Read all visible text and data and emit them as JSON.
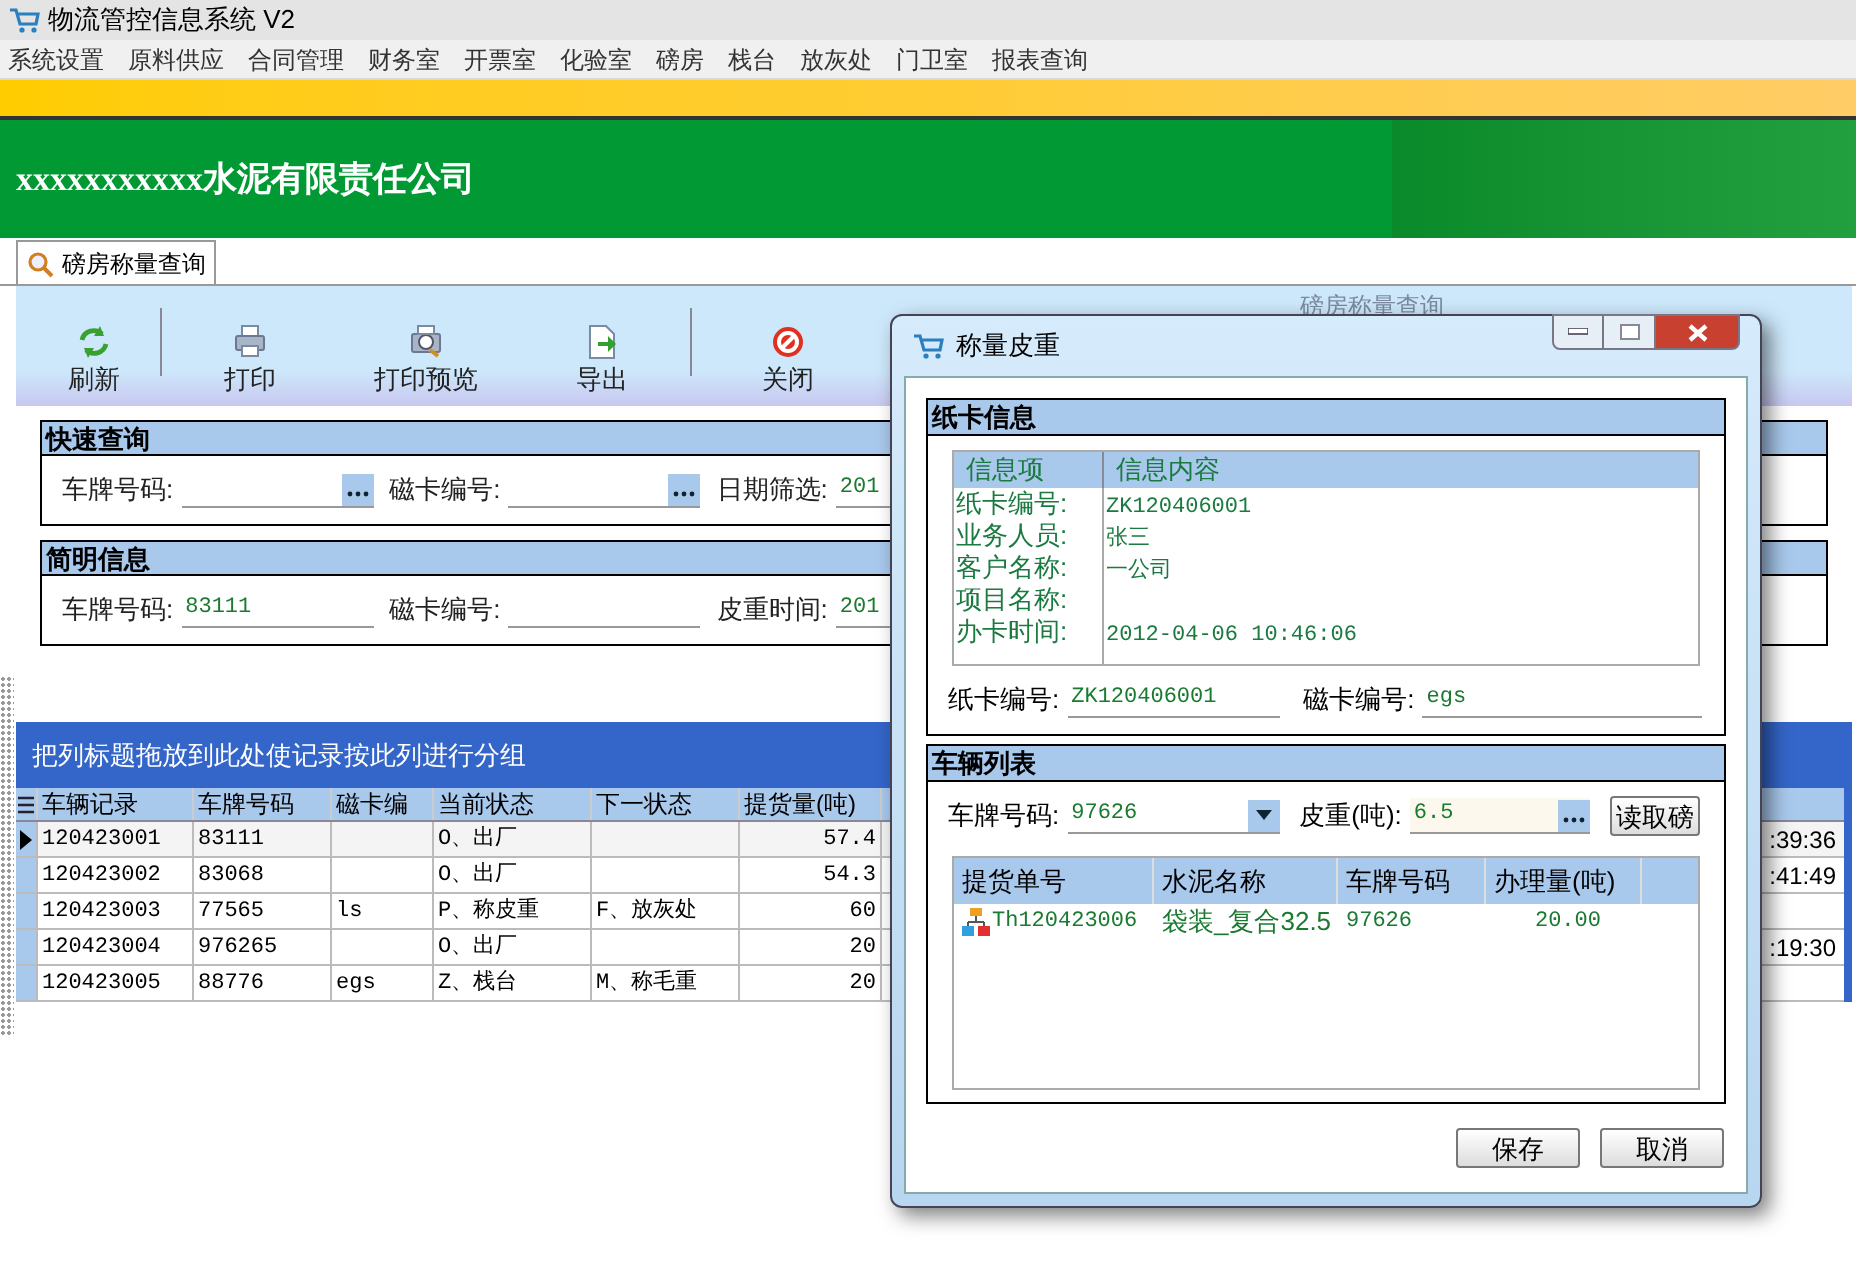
{
  "window": {
    "title": "物流管控信息系统 V2"
  },
  "menu": [
    "系统设置",
    "原料供应",
    "合同管理",
    "财务室",
    "开票室",
    "化验室",
    "磅房",
    "栈台",
    "放灰处",
    "门卫室",
    "报表查询"
  ],
  "banner": {
    "company": "xxxxxxxxxxx水泥有限责任公司"
  },
  "tabs": [
    {
      "label": "磅房称量查询",
      "selected": true
    }
  ],
  "toolbar": {
    "caption": "磅房称量查询",
    "buttons": [
      {
        "label": "刷新"
      },
      {
        "label": "打印"
      },
      {
        "label": "打印预览"
      },
      {
        "label": "导出"
      },
      {
        "label": "关闭"
      }
    ]
  },
  "quick_query": {
    "title": "快速查询",
    "fields": [
      {
        "label": "车牌号码:",
        "kind": "lookup"
      },
      {
        "label": "磁卡编号:",
        "kind": "lookup"
      },
      {
        "label": "日期筛选:",
        "value": "201",
        "kind": "text"
      }
    ]
  },
  "summary": {
    "title": "简明信息",
    "fields": [
      {
        "label": "车牌号码:",
        "value": "83111"
      },
      {
        "label": "磁卡编号:"
      },
      {
        "label": "皮重时间:",
        "value": "201"
      }
    ]
  },
  "grid": {
    "group_hint": "把列标题拖放到此处使记录按此列进行分组",
    "columns": [
      "车辆记录",
      "车牌号码",
      "磁卡编",
      "当前状态",
      "下一状态",
      "提货量(吨)"
    ],
    "rows": [
      {
        "selected": true,
        "cells": [
          "120423001",
          "83111",
          null,
          "O、出厂",
          null,
          "57.4"
        ],
        "column_7": ":39:36"
      },
      {
        "selected": false,
        "cells": [
          "120423002",
          "83068",
          null,
          "O、出厂",
          null,
          "54.3"
        ],
        "column_7": ":41:49"
      },
      {
        "selected": false,
        "cells": [
          "120423003",
          "77565",
          "ls",
          "P、称皮重",
          "F、放灰处",
          "60"
        ]
      },
      {
        "selected": false,
        "cells": [
          "120423004",
          "976265",
          null,
          "O、出厂",
          null,
          "20"
        ],
        "column_7": ":19:30"
      },
      {
        "selected": false,
        "cells": [
          "120423005",
          "88776",
          "egs",
          "Z、栈台",
          "M、称毛重",
          "20"
        ]
      }
    ]
  },
  "dialog": {
    "title": "称量皮重",
    "card_info": {
      "title": "纸卡信息",
      "columns": [
        "信息项",
        "信息内容"
      ],
      "rows": [
        {
          "item": "纸卡编号:",
          "content": "ZK120406001"
        },
        {
          "item": "业务人员:",
          "content": "张三"
        },
        {
          "item": "客户名称:",
          "content": "一公司"
        },
        {
          "item": "项目名称:"
        },
        {
          "item": "办卡时间:",
          "content": "2012-04-06 10:46:06"
        }
      ],
      "paper_card": {
        "label": "纸卡编号:",
        "value": "ZK120406001"
      },
      "mag_card": {
        "label": "磁卡编号:",
        "value": "egs"
      }
    },
    "vehicles": {
      "title": "车辆列表",
      "plate": {
        "label": "车牌号码:",
        "value": "97626"
      },
      "tare": {
        "label": "皮重(吨):",
        "value": "6.5"
      },
      "read_button": "读取磅",
      "columns": [
        "提货单号",
        "水泥名称",
        "车牌号码",
        "办理量(吨)"
      ],
      "rows": [
        {
          "cells": [
            "Th120423006",
            "袋装_复合32.5",
            "97626",
            "20.00"
          ]
        }
      ]
    },
    "buttons": [
      "保存",
      "取消"
    ]
  }
}
